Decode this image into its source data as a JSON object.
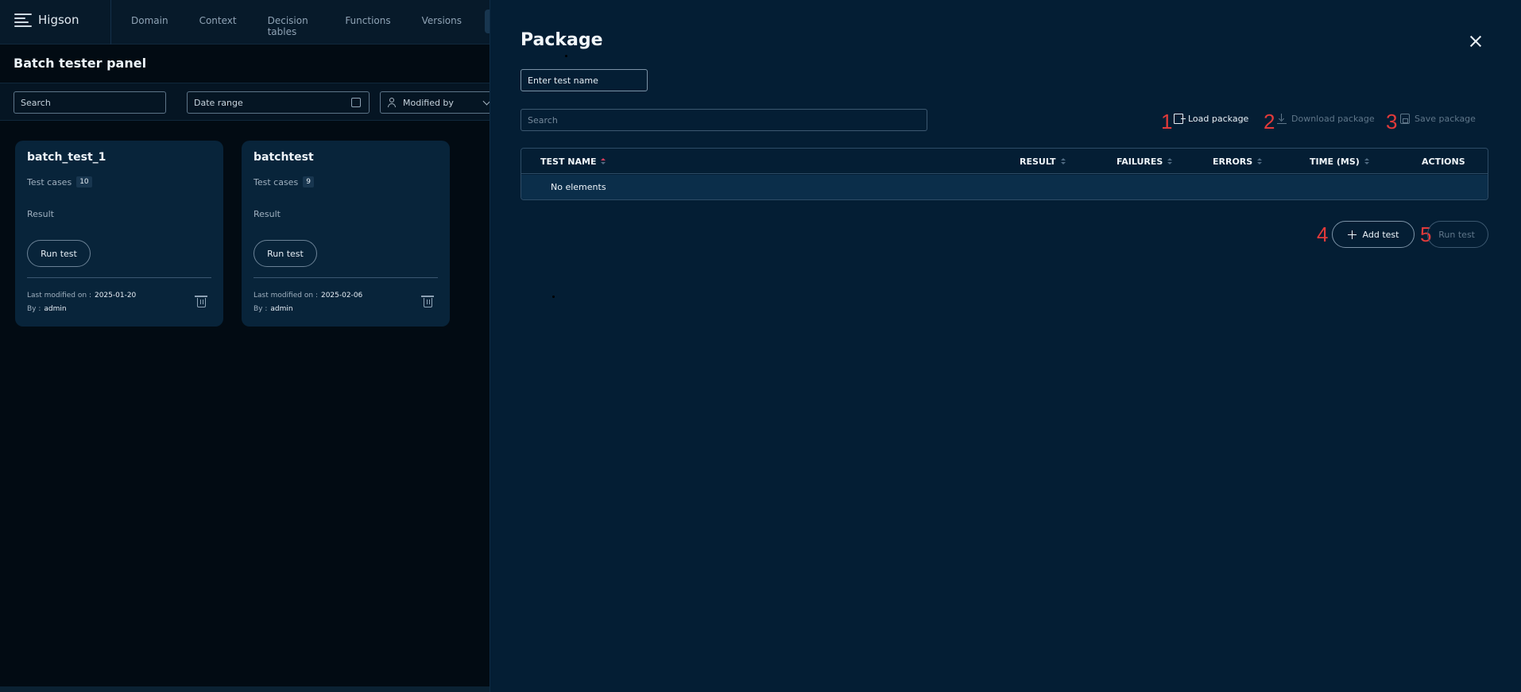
{
  "app": {
    "logo_text": "Higson",
    "nav": [
      "Domain",
      "Context",
      "Decision tables",
      "Functions",
      "Versions"
    ],
    "panel_title": "Batch tester panel",
    "filters": {
      "search_placeholder": "Search",
      "date_range_placeholder": "Date range",
      "modified_by_placeholder": "Modified by"
    },
    "cards": [
      {
        "title": "batch_test_1",
        "test_cases_label": "Test cases",
        "test_cases_count": "10",
        "result_label": "Result",
        "run_label": "Run test",
        "modified_label": "Last modified on :",
        "modified_date": "2025-01-20",
        "by_label": "By :",
        "by_user": "admin"
      },
      {
        "title": "batchtest",
        "test_cases_label": "Test cases",
        "test_cases_count": "9",
        "result_label": "Result",
        "run_label": "Run test",
        "modified_label": "Last modified on :",
        "modified_date": "2025-02-06",
        "by_label": "By :",
        "by_user": "admin"
      }
    ]
  },
  "drawer": {
    "title": "Package",
    "test_name_placeholder": "Enter test name",
    "search_placeholder": "Search",
    "actions": {
      "load": {
        "marker": "1",
        "label": "Load package",
        "enabled": true
      },
      "download": {
        "marker": "2",
        "label": "Download package",
        "enabled": false
      },
      "save": {
        "marker": "3",
        "label": "Save package",
        "enabled": false
      }
    },
    "table": {
      "columns": [
        "TEST NAME",
        "RESULT",
        "FAILURES",
        "ERRORS",
        "TIME (MS)",
        "ACTIONS"
      ],
      "empty_text": "No elements"
    },
    "buttons": {
      "add": {
        "marker": "4",
        "label": "Add test"
      },
      "run": {
        "marker": "5",
        "label": "Run test",
        "enabled": false
      }
    }
  },
  "colors": {
    "background": "#030d16",
    "drawer_bg": "#041e34",
    "card_bg": "#08243a",
    "annotation_red": "#e23a3a",
    "sort_active": "#d43c5c"
  }
}
